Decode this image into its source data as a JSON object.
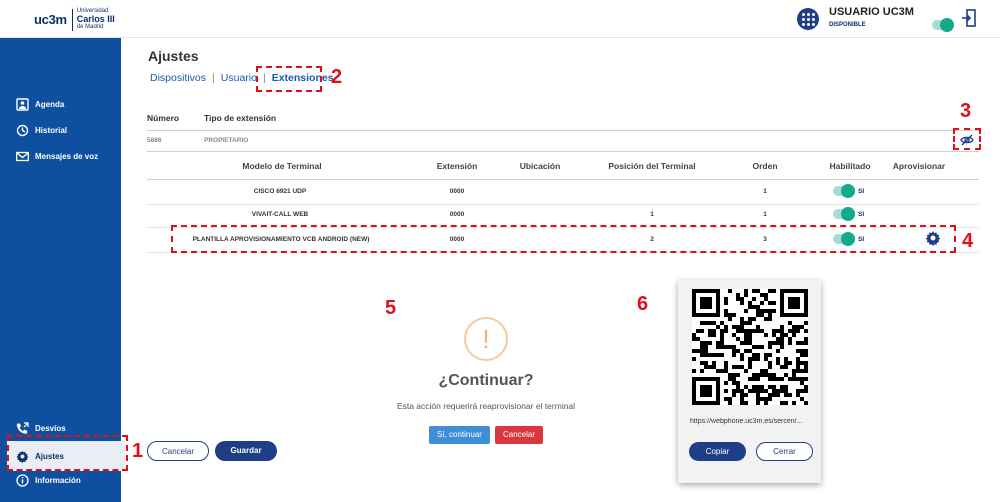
{
  "header": {
    "logo_short": "uc3m",
    "logo_line1": "Universidad",
    "logo_line2": "Carlos III",
    "logo_line3": "de Madrid",
    "user_name": "USUARIO UC3M",
    "user_status": "DISPONIBLE"
  },
  "sidebar": {
    "items": [
      {
        "label": "Agenda",
        "icon": "calendar-icon"
      },
      {
        "label": "Historial",
        "icon": "history-icon"
      },
      {
        "label": "Mensajes de voz",
        "icon": "mail-icon"
      },
      {
        "label": "Desvíos",
        "icon": "phone-forward-icon"
      },
      {
        "label": "Ajustes",
        "icon": "gear-icon"
      },
      {
        "label": "Información",
        "icon": "info-icon"
      }
    ]
  },
  "page": {
    "title": "Ajustes",
    "tabs": [
      "Dispositivos",
      "Usuario",
      "Extensiones"
    ],
    "active_tab": "Extensiones"
  },
  "extension": {
    "number_label": "Número",
    "type_label": "Tipo de extensión",
    "number": "5886",
    "type": "PROPIETARIO"
  },
  "table": {
    "headers": [
      "Modelo de Terminal",
      "Extensión",
      "Ubicación",
      "Posición del Terminal",
      "Orden",
      "Habilitado",
      "Aprovisionar"
    ],
    "rows": [
      {
        "model": "CISCO 6921 UDP",
        "extension": "0000",
        "location": "",
        "position": "",
        "order": "1",
        "enabled": "SI"
      },
      {
        "model": "VIVAIT-CALL WEB",
        "extension": "0000",
        "location": "",
        "position": "1",
        "order": "1",
        "enabled": "SI"
      },
      {
        "model": "PLANTILLA APROVISIONAMIENTO VCB ANDROID (NEW)",
        "extension": "0000",
        "location": "",
        "position": "2",
        "order": "3",
        "enabled": "SI"
      }
    ]
  },
  "form": {
    "cancel": "Cancelar",
    "save": "Guardar"
  },
  "dialog": {
    "icon": "!",
    "title": "¿Continuar?",
    "message": "Esta acción requerirá reaprovisionar el terminal",
    "confirm": "Sí, continuar",
    "cancel": "Cancelar",
    "confirm_color": "#3f8ed8",
    "cancel_color": "#d9363e"
  },
  "qr": {
    "url": "https://webphone.uc3m.es/sercen/...",
    "copy": "Copiar",
    "close": "Cerrar"
  },
  "annotations": [
    "1",
    "2",
    "3",
    "4",
    "5",
    "6"
  ],
  "colors": {
    "sidebar": "#0e4fa0",
    "accent": "#1e3f86",
    "toggle": "#13a98c",
    "annotation": "#e0101a"
  }
}
